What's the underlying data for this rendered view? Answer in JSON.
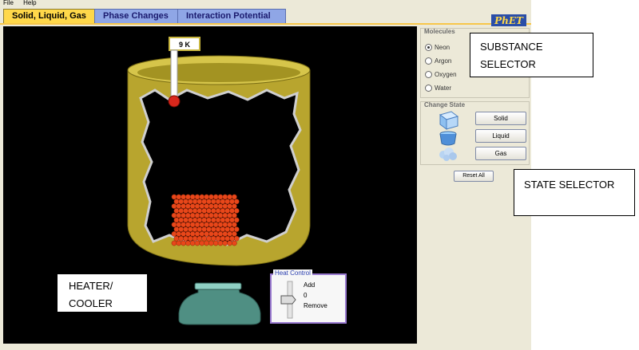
{
  "menu": [
    "File",
    "Help"
  ],
  "tabs": [
    "Solid, Liquid, Gas",
    "Phase Changes",
    "Interaction Potential"
  ],
  "logo": "PhET",
  "thermometer_label": "9 K",
  "molecules": {
    "title": "Molecules",
    "options": [
      "Neon",
      "Argon",
      "Oxygen",
      "Water"
    ],
    "selected": "Neon"
  },
  "change_state": {
    "title": "Change State",
    "buttons": [
      "Solid",
      "Liquid",
      "Gas"
    ]
  },
  "reset_label": "Reset All",
  "heat_control": {
    "title": "Heat Control",
    "add": "Add",
    "value": "0",
    "remove": "Remove",
    "level": 0.5
  },
  "annotations": {
    "substance_1": "SUBSTANCE",
    "substance_2": "SELECTOR",
    "state": "STATE SELECTOR",
    "heater_1": "HEATER/",
    "heater_2": "COOLER"
  },
  "colors": {
    "container": "#b8a52e",
    "particle": "#e8471a",
    "tab_active": "#ffd84a",
    "tab_inactive": "#8fa6e6"
  }
}
